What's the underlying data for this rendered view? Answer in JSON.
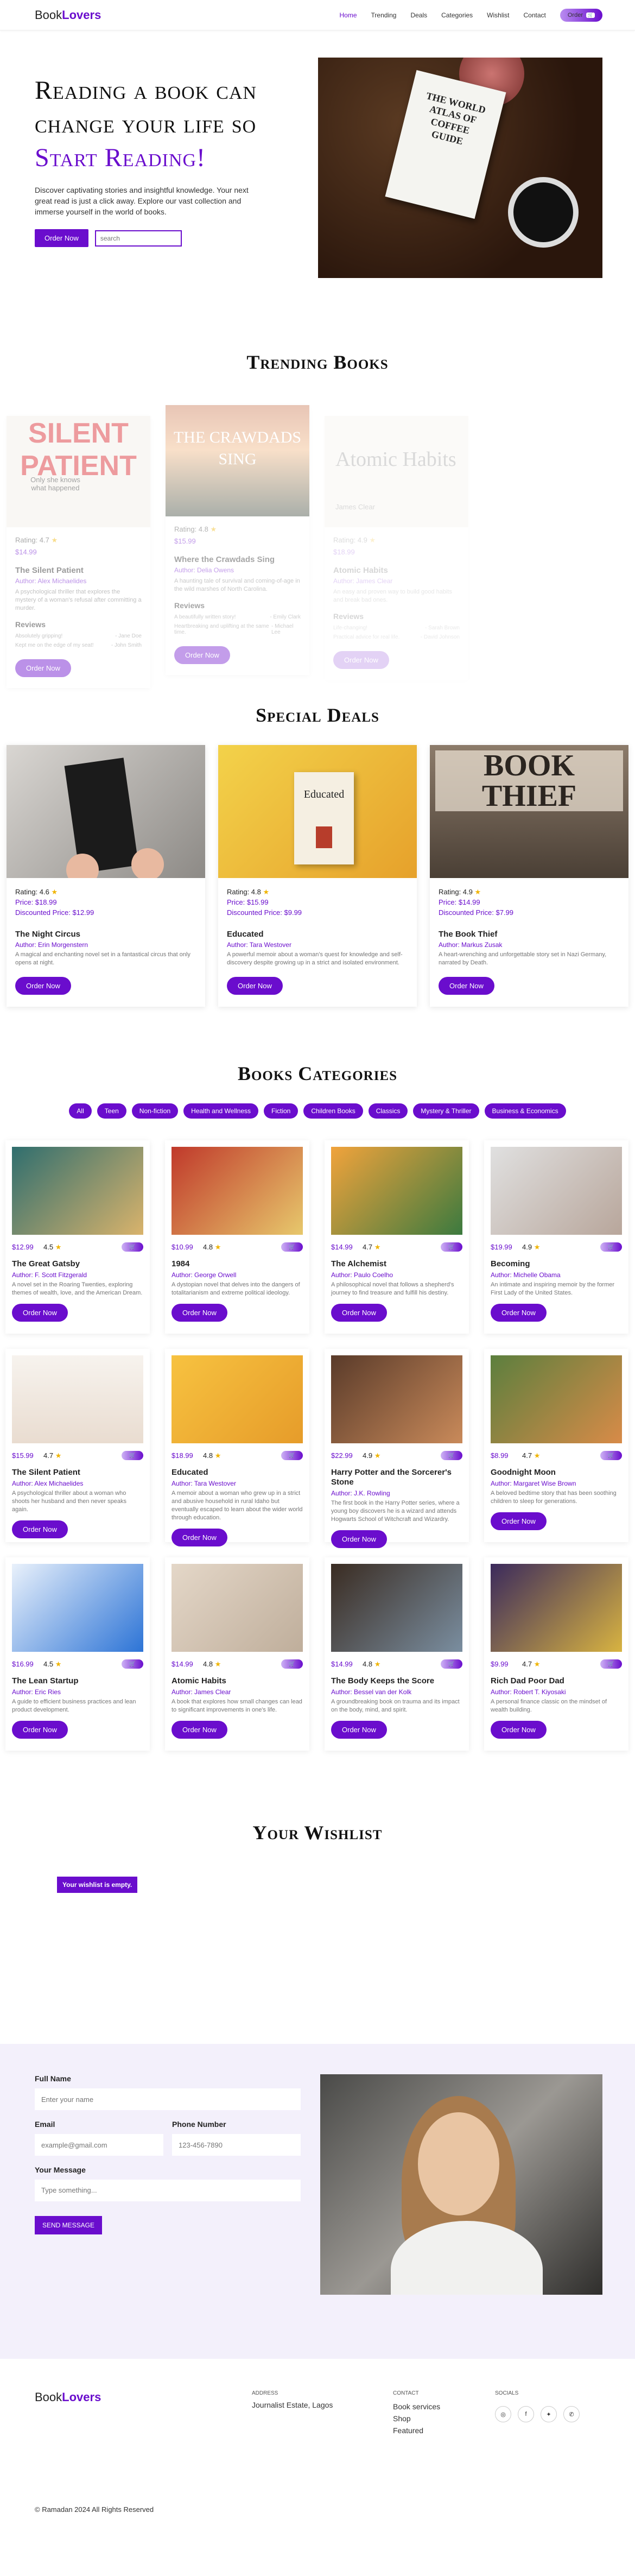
{
  "nav": {
    "logo_a": "Book",
    "logo_b": "Lovers",
    "links": [
      "Home",
      "Trending",
      "Deals",
      "Categories",
      "Wishlist",
      "Contact"
    ],
    "order_label": "Order"
  },
  "hero": {
    "line1": "Reading a book can",
    "line2": "change your life so",
    "line3": "Start Reading!",
    "text": "Discover captivating stories and insightful knowledge. Your next great read is just a click away. Explore our vast collection and immerse yourself in the world of books.",
    "order_btn": "Order Now",
    "search_placeholder": "search",
    "image_text": "THE WORLD ATLAS OF COFFEE GUIDE"
  },
  "trending": {
    "title": "Trending Books",
    "cards": [
      {
        "cover_text": "SILENT PATIENT",
        "cover_sub": "Only she knows what happened",
        "rating": "Rating: 4.7",
        "price": "$14.99",
        "title": "The Silent Patient",
        "author": "Author: Alex Michaelides",
        "desc": "A psychological thriller that explores the mystery of a woman's refusal after committing a murder.",
        "reviews_label": "Reviews",
        "reviews": [
          {
            "text": "Absolutely gripping!",
            "by": "- Jane Doe"
          },
          {
            "text": "Kept me on the edge of my seat!",
            "by": "- John Smith"
          }
        ],
        "btn": "Order Now"
      },
      {
        "cover_text": "THE CRAWDADS SING",
        "cover_sub": "",
        "rating": "Rating: 4.8",
        "price": "$15.99",
        "title": "Where the Crawdads Sing",
        "author": "Author: Delia Owens",
        "desc": "A haunting tale of survival and coming-of-age in the wild marshes of North Carolina.",
        "reviews_label": "Reviews",
        "reviews": [
          {
            "text": "A beautifully written story!",
            "by": "- Emily Clark"
          },
          {
            "text": "Heartbreaking and uplifting at the same time.",
            "by": "- Michael Lee"
          }
        ],
        "btn": "Order Now"
      },
      {
        "cover_text": "Atomic Habits",
        "cover_sub": "James Clear",
        "rating": "Rating: 4.9",
        "price": "$18.99",
        "title": "Atomic Habits",
        "author": "Author: James Clear",
        "desc": "An easy and proven way to build good habits and break bad ones.",
        "reviews_label": "Reviews",
        "reviews": [
          {
            "text": "Life-changing!",
            "by": "- Sarah Brown"
          },
          {
            "text": "Practical advice for real life.",
            "by": "- David Johnson"
          }
        ],
        "btn": "Order Now"
      }
    ]
  },
  "deals": {
    "title": "Special Deals",
    "cards": [
      {
        "rating": "Rating: 4.6",
        "price": "Price: $18.99",
        "discount": "Discounted Price: $12.99",
        "title": "The Night Circus",
        "author": "Author: Erin Morgenstern",
        "desc": "A magical and enchanting novel set in a fantastical circus that only opens at night.",
        "btn": "Order Now"
      },
      {
        "rating": "Rating: 4.8",
        "price": "Price: $15.99",
        "discount": "Discounted Price: $9.99",
        "title": "Educated",
        "author": "Author: Tara Westover",
        "desc": "A powerful memoir about a woman's quest for knowledge and self-discovery despite growing up in a strict and isolated environment.",
        "btn": "Order Now"
      },
      {
        "rating": "Rating: 4.9",
        "price": "Price: $14.99",
        "discount": "Discounted Price: $7.99",
        "title": "The Book Thief",
        "author": "Author: Markus Zusak",
        "desc": "A heart-wrenching and unforgettable story set in Nazi Germany, narrated by Death.",
        "btn": "Order Now"
      }
    ]
  },
  "categories": {
    "title": "Books Categories",
    "chips": [
      "All",
      "Teen",
      "Non-fiction",
      "Health and Wellness",
      "Fiction",
      "Children Books",
      "Classics",
      "Mystery & Thriller",
      "Business & Economics"
    ],
    "books": [
      {
        "price": "$12.99",
        "rating": "4.5",
        "title": "The Great Gatsby",
        "author": "Author: F. Scott Fitzgerald",
        "desc": "A novel set in the Roaring Twenties, exploring themes of wealth, love, and the American Dream.",
        "btn": "Order Now",
        "cart": "🛒"
      },
      {
        "price": "$10.99",
        "rating": "4.8",
        "title": "1984",
        "author": "Author: George Orwell",
        "desc": "A dystopian novel that delves into the dangers of totalitarianism and extreme political ideology.",
        "btn": "Order Now",
        "cart": "🛒"
      },
      {
        "price": "$14.99",
        "rating": "4.7",
        "title": "The Alchemist",
        "author": "Author: Paulo Coelho",
        "desc": "A philosophical novel that follows a shepherd's journey to find treasure and fulfill his destiny.",
        "btn": "Order Now",
        "cart": "🛒"
      },
      {
        "price": "$19.99",
        "rating": "4.9",
        "title": "Becoming",
        "author": "Author: Michelle Obama",
        "desc": "An intimate and inspiring memoir by the former First Lady of the United States.",
        "btn": "Order Now",
        "cart": "🛒"
      },
      {
        "price": "$15.99",
        "rating": "4.7",
        "title": "The Silent Patient",
        "author": "Author: Alex Michaelides",
        "desc": "A psychological thriller about a woman who shoots her husband and then never speaks again.",
        "btn": "Order Now",
        "cart": "🛒"
      },
      {
        "price": "$18.99",
        "rating": "4.8",
        "title": "Educated",
        "author": "Author: Tara Westover",
        "desc": "A memoir about a woman who grew up in a strict and abusive household in rural Idaho but eventually escaped to learn about the wider world through education.",
        "btn": "Order Now",
        "cart": "🛒"
      },
      {
        "price": "$22.99",
        "rating": "4.9",
        "title": "Harry Potter and the Sorcerer's Stone",
        "author": "Author: J.K. Rowling",
        "desc": "The first book in the Harry Potter series, where a young boy discovers he is a wizard and attends Hogwarts School of Witchcraft and Wizardry.",
        "btn": "Order Now",
        "cart": "🛒"
      },
      {
        "price": "$8.99",
        "rating": "4.7",
        "title": "Goodnight Moon",
        "author": "Author: Margaret Wise Brown",
        "desc": "A beloved bedtime story that has been soothing children to sleep for generations.",
        "btn": "Order Now",
        "cart": "🛒"
      },
      {
        "price": "$16.99",
        "rating": "4.5",
        "title": "The Lean Startup",
        "author": "Author: Eric Ries",
        "desc": "A guide to efficient business practices and lean product development.",
        "btn": "Order Now",
        "cart": "🛒"
      },
      {
        "price": "$14.99",
        "rating": "4.8",
        "title": "Atomic Habits",
        "author": "Author: James Clear",
        "desc": "A book that explores how small changes can lead to significant improvements in one's life.",
        "btn": "Order Now",
        "cart": "🛒"
      },
      {
        "price": "$14.99",
        "rating": "4.8",
        "title": "The Body Keeps the Score",
        "author": "Author: Bessel van der Kolk",
        "desc": "A groundbreaking book on trauma and its impact on the body, mind, and spirit.",
        "btn": "Order Now",
        "cart": "🛒"
      },
      {
        "price": "$9.99",
        "rating": "4.7",
        "title": "Rich Dad Poor Dad",
        "author": "Author: Robert T. Kiyosaki",
        "desc": "A personal finance classic on the mindset of wealth building.",
        "btn": "Order Now",
        "cart": "🛒"
      }
    ]
  },
  "wishlist": {
    "title": "Your Wishlist",
    "empty": "Your wishlist is empty."
  },
  "contact": {
    "name_label": "Full Name",
    "name_placeholder": "Enter your name",
    "email_label": "Email",
    "email_placeholder": "example@gmail.com",
    "phone_label": "Phone Number",
    "phone_placeholder": "123-456-7890",
    "message_label": "Your Message",
    "message_placeholder": "Type something...",
    "send": "SEND MESSAGE"
  },
  "footer": {
    "logo_a": "Book",
    "logo_b": "Lovers",
    "address_head": "Address",
    "address": "Journalist Estate, Lagos",
    "contact_head": "Contact",
    "contact_items": [
      "Book services",
      "Shop",
      "Featured"
    ],
    "socials_head": "Socials",
    "copyright": "© Ramadan 2024 All Rights Reserved"
  },
  "colors": {
    "accent": "#6a0dcd",
    "star": "#f0b400",
    "contact_bg": "#f3f0fb"
  }
}
